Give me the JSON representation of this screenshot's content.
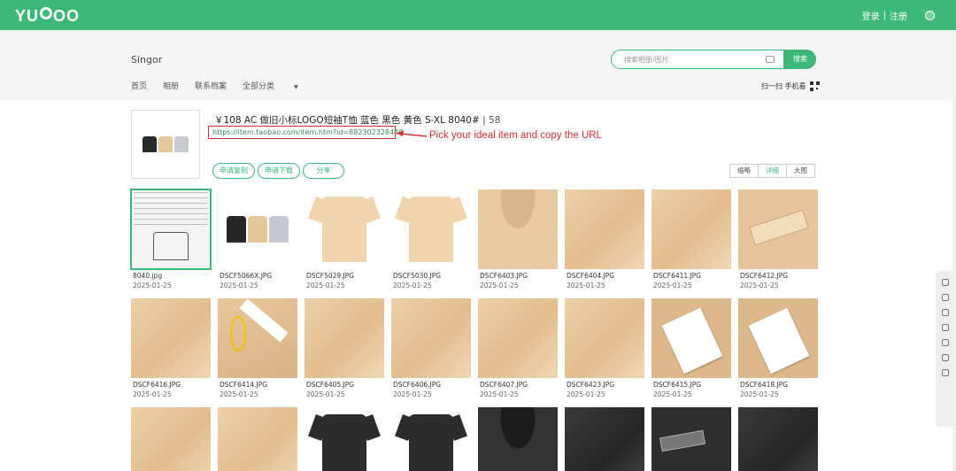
{
  "topbar": {
    "logo": "YUPOO",
    "login": "登录",
    "separator": "|",
    "register": "注册"
  },
  "header": {
    "owner": "Singor",
    "nav": [
      "首页",
      "相册",
      "联系档案",
      "全部分类"
    ],
    "search_placeholder": "搜索相册/图片",
    "search_button": "搜索",
    "scan_label": "扫一扫 手机看"
  },
  "album": {
    "title": "￥108 AC 做旧小标LOGO短袖T恤 蓝色 黑色 黄色 S-XL 8040#",
    "separator": "|",
    "count": "58",
    "url": "https://item.taobao.com/item.htm?id=882302328440",
    "callout": "Pick your ideal item and copy the URL",
    "actions": [
      "申请复制",
      "申请下载",
      "分享"
    ],
    "views": [
      "缩略",
      "详细",
      "大图"
    ],
    "selected_view": "详细"
  },
  "colors": {
    "brand": "#3cb878",
    "annotation": "#d32f2f"
  },
  "photos": [
    {
      "name": "8040.jpg",
      "date": "2025-01-25",
      "kind": "sizechart"
    },
    {
      "name": "DSCF5066X.JPG",
      "date": "2025-01-25",
      "kind": "group"
    },
    {
      "name": "DSCF5029.JPG",
      "date": "2025-01-25",
      "kind": "tee"
    },
    {
      "name": "DSCF5030.JPG",
      "date": "2025-01-25",
      "kind": "tee"
    },
    {
      "name": "DSCF6403.JPG",
      "date": "2025-01-25",
      "kind": "collar"
    },
    {
      "name": "DSCF6404.JPG",
      "date": "2025-01-25",
      "kind": "fabric"
    },
    {
      "name": "DSCF6411.JPG",
      "date": "2025-01-25",
      "kind": "fabric"
    },
    {
      "name": "DSCF6412.JPG",
      "date": "2025-01-25",
      "kind": "patch"
    },
    {
      "name": "DSCF6416.JPG",
      "date": "2025-01-25",
      "kind": "fabric"
    },
    {
      "name": "DSCF6414.JPG",
      "date": "2025-01-25",
      "kind": "tag"
    },
    {
      "name": "DSCF6405.JPG",
      "date": "2025-01-25",
      "kind": "fabric"
    },
    {
      "name": "DSCF6406.JPG",
      "date": "2025-01-25",
      "kind": "fabric"
    },
    {
      "name": "DSCF6407.JPG",
      "date": "2025-01-25",
      "kind": "fabric"
    },
    {
      "name": "DSCF6423.JPG",
      "date": "2025-01-25",
      "kind": "fabric"
    },
    {
      "name": "DSCF6415.JPG",
      "date": "2025-01-25",
      "kind": "whitetag"
    },
    {
      "name": "DSCF6418.JPG",
      "date": "2025-01-25",
      "kind": "whitetag"
    },
    {
      "name": "",
      "date": "",
      "kind": "fabric"
    },
    {
      "name": "",
      "date": "",
      "kind": "fabric"
    },
    {
      "name": "",
      "date": "",
      "kind": "darktee"
    },
    {
      "name": "",
      "date": "",
      "kind": "darktee"
    },
    {
      "name": "",
      "date": "",
      "kind": "darkcollar"
    },
    {
      "name": "",
      "date": "",
      "kind": "darkfabric"
    },
    {
      "name": "",
      "date": "",
      "kind": "darkpatch"
    },
    {
      "name": "",
      "date": "",
      "kind": "darkfabric"
    }
  ]
}
